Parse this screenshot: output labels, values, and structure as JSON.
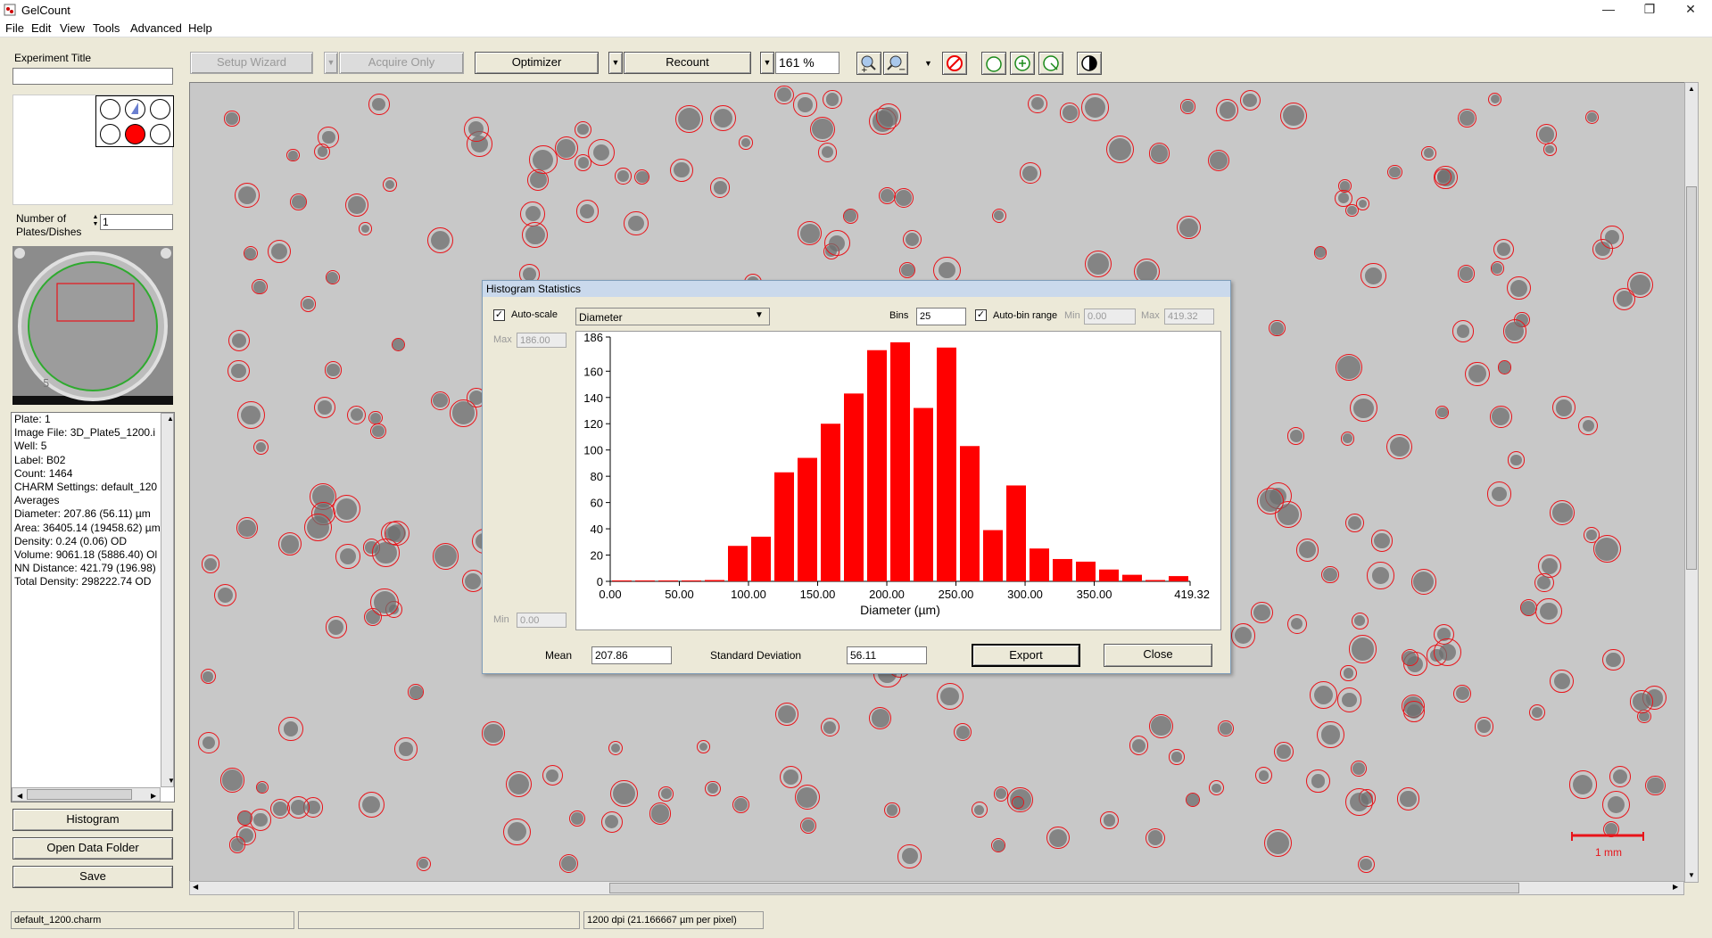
{
  "window": {
    "title": "GelCount",
    "minimize": "—",
    "restore": "❐",
    "close": "✕"
  },
  "menu": [
    "File",
    "Edit",
    "View",
    "Tools",
    "Advanced",
    "Help"
  ],
  "toolbar": {
    "setup_wizard": "Setup Wizard",
    "acquire_only": "Acquire Only",
    "optimizer": "Optimizer",
    "recount": "Recount",
    "zoom": "161 %"
  },
  "left": {
    "experiment_title_label": "Experiment Title",
    "experiment_title_value": "",
    "plates_label_1": "Number of",
    "plates_label_2": "Plates/Dishes",
    "plates_value": "1",
    "info": [
      "Plate: 1",
      "Image File: 3D_Plate5_1200.i",
      "Well:  5",
      "Label:  B02",
      "Count: 1464",
      "CHARM Settings: default_120",
      "Averages",
      "Diameter: 207.86 (56.11) µm",
      "Area: 36405.14 (19458.62) µm",
      "Density: 0.24 (0.06) OD",
      "Volume: 9061.18 (5886.40) Ol",
      "NN Distance: 421.79 (196.98)",
      "Total Density: 298222.74 OD"
    ],
    "histogram_btn": "Histogram",
    "open_data_btn": "Open Data Folder",
    "save_btn": "Save"
  },
  "scalebar": {
    "label": "1 mm"
  },
  "dialog": {
    "title": "Histogram Statistics",
    "autoscale_label": "Auto-scale",
    "autoscale_checked": true,
    "measure": "Diameter",
    "bins_label": "Bins",
    "bins_value": "25",
    "autobin_label": "Auto-bin range",
    "autobin_checked": true,
    "min_label": "Min",
    "min_value": "0.00",
    "max_label": "Max",
    "max_value": "419.32",
    "ymax_label": "Max",
    "ymax_value": "186.00",
    "ymin_label": "Min",
    "ymin_value": "0.00",
    "mean_label": "Mean",
    "mean_value": "207.86",
    "sd_label": "Standard Deviation",
    "sd_value": "56.11",
    "export_btn": "Export",
    "close_btn": "Close"
  },
  "chart_data": {
    "type": "bar",
    "xlabel": "Diameter (µm)",
    "x_ticks": [
      "0.00",
      "50.00",
      "100.00",
      "150.00",
      "200.00",
      "250.00",
      "300.00",
      "350.00",
      "419.32"
    ],
    "y_ticks": [
      "0",
      "20",
      "40",
      "60",
      "80",
      "100",
      "120",
      "140",
      "160",
      "186"
    ],
    "ylim": [
      0,
      186
    ],
    "xlim": [
      0,
      419.32
    ],
    "bin_width": 16.7728,
    "values": [
      0,
      0,
      0,
      0,
      1,
      27,
      34,
      83,
      94,
      120,
      143,
      176,
      182,
      132,
      178,
      103,
      39,
      73,
      25,
      17,
      15,
      9,
      5,
      1,
      4
    ],
    "bar_color": "#ff0000"
  },
  "status": {
    "cell1": "default_1200.charm",
    "cell2": "",
    "cell3": "1200 dpi (21.166667 µm per pixel)"
  }
}
